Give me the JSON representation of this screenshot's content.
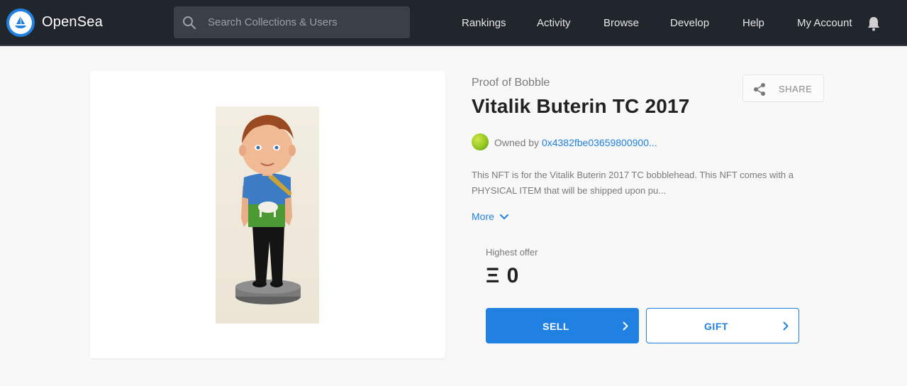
{
  "header": {
    "brand": "OpenSea",
    "search_placeholder": "Search Collections & Users",
    "nav": [
      "Rankings",
      "Activity",
      "Browse",
      "Develop",
      "Help",
      "My Account"
    ]
  },
  "asset": {
    "collection": "Proof of Bobble",
    "title": "Vitalik Buterin TC 2017",
    "share_label": "SHARE",
    "owned_by_label": "Owned by",
    "owner_address": "0x4382fbe03659800900...",
    "description": "This NFT is for the Vitalik Buterin 2017 TC bobblehead. This NFT comes with a PHYSICAL ITEM that will be shipped upon pu...",
    "more_label": "More",
    "highest_offer_label": "Highest offer",
    "highest_offer_value": "Ξ 0",
    "sell_label": "SELL",
    "gift_label": "GIFT"
  },
  "colors": {
    "accent": "#2081e2",
    "header_bg": "#21262d",
    "page_bg": "#f8f8f8"
  },
  "icons": {
    "logo": "opensea-logo-icon",
    "search": "search-icon",
    "notifications": "bell-icon",
    "share": "share-icon",
    "more": "chevron-down-icon",
    "buttons": "chevron-right-icon"
  }
}
